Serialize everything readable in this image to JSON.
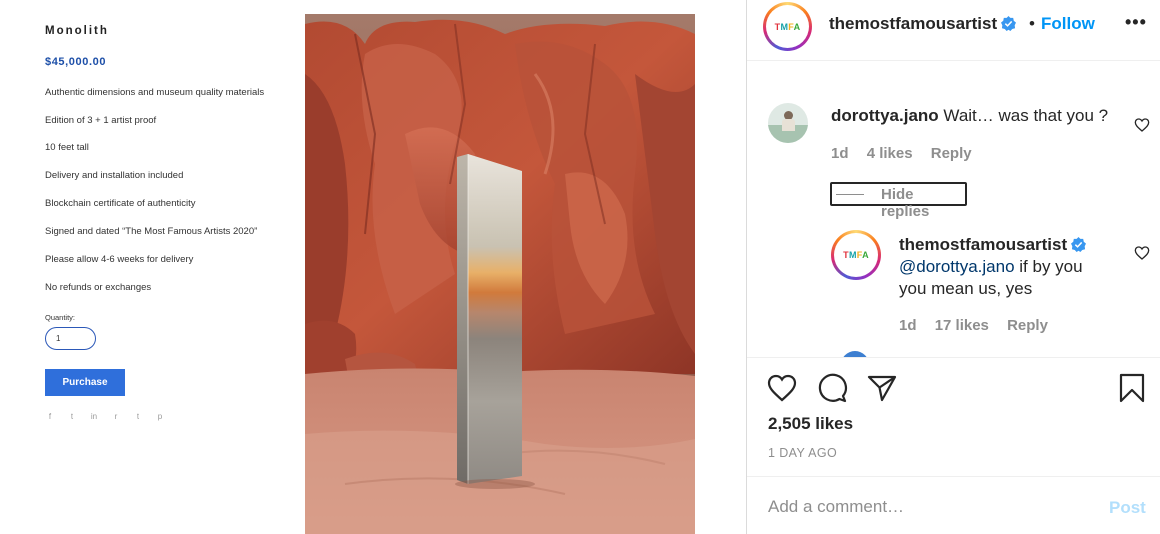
{
  "product": {
    "title": "Monolith",
    "price": "$45,000.00",
    "features": [
      "Authentic dimensions and museum quality materials",
      "Edition of 3 + 1 artist proof",
      "10 feet tall",
      "Delivery and installation included",
      "Blockchain certificate of authenticity",
      "Signed and dated “The Most Famous Artists 2020”",
      "Please allow 4-6 weeks for delivery",
      "No refunds or exchanges"
    ],
    "quantity_label": "Quantity:",
    "quantity_value": "1",
    "purchase_label": "Purchase",
    "share_icons": [
      "f",
      "t",
      "in",
      "r",
      "t",
      "p"
    ],
    "accent_color": "#2f6fdb"
  },
  "photo": {
    "subject": "monolith-in-red-rock-canyon"
  },
  "instagram": {
    "header": {
      "avatar_text": "TMFA",
      "username": "themostfamousartist",
      "dot": "•",
      "follow_label": "Follow",
      "more_label": "•••"
    },
    "comments": [
      {
        "user": "dorottya.jano",
        "text": "Wait… was that you ?",
        "age": "1d",
        "likes": "4 likes",
        "reply_label": "Reply"
      }
    ],
    "hide_replies_label": "Hide replies",
    "reply": {
      "user": "themostfamousartist",
      "mention": "@dorottya.jano",
      "text_line1_rest": " if by you",
      "text_line2": "you mean us, yes",
      "age": "1d",
      "likes": "17 likes",
      "reply_label": "Reply"
    },
    "likes_count": "2,505 likes",
    "time_ago": "1 DAY AGO",
    "add_comment_placeholder": "Add a comment…",
    "post_label": "Post",
    "colors": {
      "link_blue": "#0095f6",
      "verified_blue": "#3897f0",
      "muted_gray": "#8e8e8e",
      "post_disabled": "#b2dffc"
    }
  }
}
